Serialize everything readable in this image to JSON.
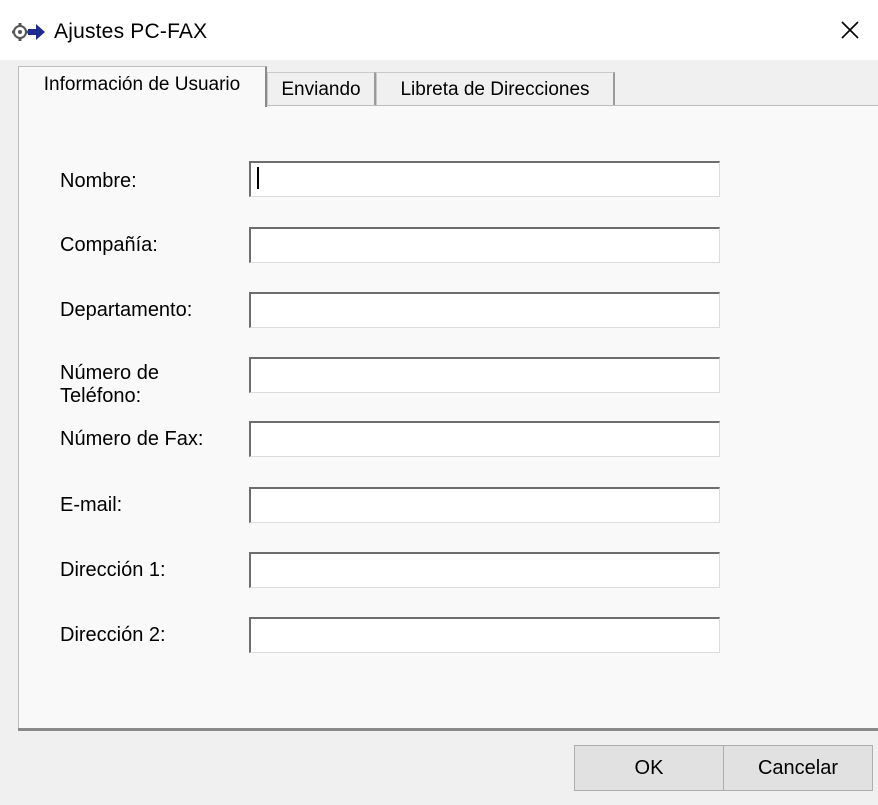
{
  "window": {
    "title": "Ajustes PC-FAX",
    "icon": "fax-settings-icon",
    "close_glyph": "✕"
  },
  "tabs": [
    {
      "label": "Información de Usuario",
      "active": true
    },
    {
      "label": "Enviando",
      "active": false
    },
    {
      "label": "Libreta de Direcciones",
      "active": false
    }
  ],
  "form": {
    "fields": [
      {
        "label": "Nombre:",
        "value": ""
      },
      {
        "label": "Compañía:",
        "value": ""
      },
      {
        "label": "Departamento:",
        "value": ""
      },
      {
        "label_line1": "Número de",
        "label_line2": "Teléfono:",
        "value": ""
      },
      {
        "label": "Número de Fax:",
        "value": ""
      },
      {
        "label": "E-mail:",
        "value": ""
      },
      {
        "label": "Dirección 1:",
        "value": ""
      },
      {
        "label": "Dirección 2:",
        "value": ""
      }
    ]
  },
  "buttons": {
    "ok": "OK",
    "cancel": "Cancelar"
  },
  "colors": {
    "window_bg": "#f0f0f0",
    "titlebar_bg": "#ffffff",
    "panel_bg": "#f9f9f9",
    "button_bg": "#e1e1e1"
  }
}
